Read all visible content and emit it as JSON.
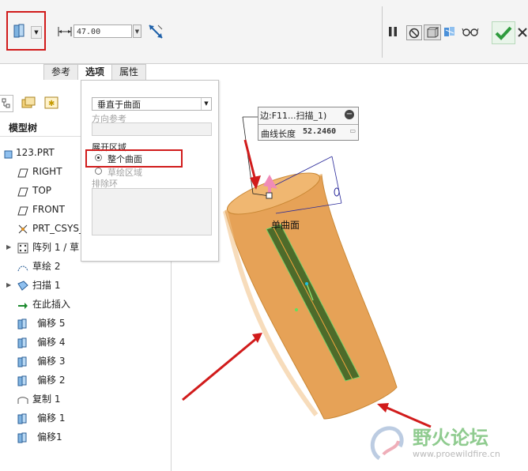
{
  "toolbar": {
    "dimension_value": "47.00",
    "icons": [
      "offset-feature-icon",
      "dropdown-arrow-icon",
      "dimension-width-icon",
      "flip-direction-icon",
      "pause-icon",
      "no-preview-icon",
      "geometry-preview-icon",
      "feature-preview-icon",
      "glasses-preview-icon",
      "confirm-check-icon",
      "cancel-x-icon"
    ]
  },
  "tabs": [
    {
      "label": "参考"
    },
    {
      "label": "选项"
    },
    {
      "label": "属性"
    }
  ],
  "options_panel": {
    "select_value": "垂直于曲面",
    "direction_ref_label": "方向参考",
    "expand_area_label": "展开区域",
    "radio_whole_surface": "整个曲面",
    "radio_sketch_area": "草绘区域",
    "exclude_ring_label": "排除环"
  },
  "model_tree": {
    "title": "模型树",
    "items": [
      {
        "label": "123.PRT",
        "icon": "part-icon"
      },
      {
        "label": "RIGHT",
        "icon": "datum-plane-icon"
      },
      {
        "label": "TOP",
        "icon": "datum-plane-icon"
      },
      {
        "label": "FRONT",
        "icon": "datum-plane-icon"
      },
      {
        "label": "PRT_CSYS_",
        "icon": "coordinate-system-icon"
      },
      {
        "label": "阵列 1 / 草",
        "icon": "pattern-icon"
      },
      {
        "label": "草绘 2",
        "icon": "sketch-icon"
      },
      {
        "label": "扫描 1",
        "icon": "sweep-icon"
      },
      {
        "label": "在此插入",
        "icon": "insert-here-arrow-icon"
      },
      {
        "label": "偏移 5",
        "icon": "offset-icon"
      },
      {
        "label": "偏移 4",
        "icon": "offset-icon"
      },
      {
        "label": "偏移 3",
        "icon": "offset-icon"
      },
      {
        "label": "偏移 2",
        "icon": "offset-icon"
      },
      {
        "label": "复制 1",
        "icon": "copy-icon"
      },
      {
        "label": "偏移 1",
        "icon": "offset-icon"
      },
      {
        "label": "偏移1",
        "icon": "offset-icon"
      }
    ]
  },
  "viewport": {
    "callout_edge": "边:F11...扫描_1)",
    "curve_length_label": "曲线长度",
    "curve_length_value": "52.2460",
    "surface_label": "单曲面"
  },
  "watermark": {
    "title": "野火论坛",
    "url": "www.proewildfire.cn"
  },
  "colors": {
    "highlight_red": "#d11b1b",
    "part_orange": "#e8a55a",
    "surface_green": "#4d6b2a",
    "confirm_green": "#2e9b3d",
    "pink_arrow": "#f08bb8"
  }
}
